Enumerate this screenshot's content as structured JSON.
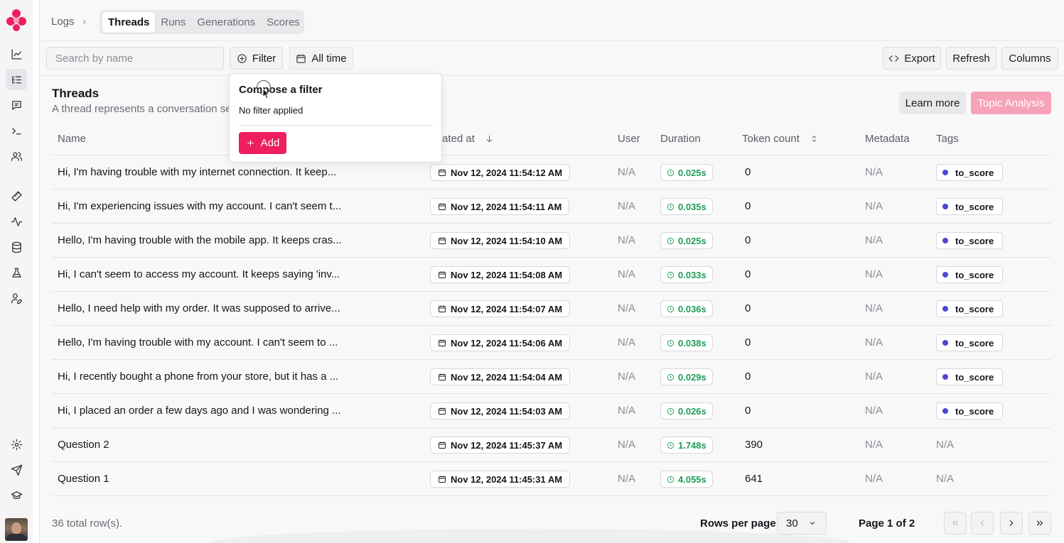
{
  "brand": {
    "accent": "#ef1e5f",
    "accent_light": "#f6a2b8"
  },
  "nav": {
    "items": [
      {
        "icon": "chart-line-icon"
      },
      {
        "icon": "list-tree-icon",
        "active": true
      },
      {
        "icon": "message-square-icon"
      },
      {
        "icon": "terminal-icon"
      },
      {
        "icon": "users-icon"
      },
      {
        "icon": "ruler-icon"
      },
      {
        "icon": "activity-icon"
      },
      {
        "icon": "database-icon"
      },
      {
        "icon": "flask-icon"
      },
      {
        "icon": "user-pen-icon"
      }
    ],
    "bottom_items": [
      {
        "icon": "settings-gear-icon"
      },
      {
        "icon": "send-icon"
      },
      {
        "icon": "graduation-cap-icon"
      }
    ]
  },
  "header": {
    "breadcrumb": "Logs",
    "tabs": [
      {
        "label": "Threads",
        "active": true
      },
      {
        "label": "Runs"
      },
      {
        "label": "Generations"
      },
      {
        "label": "Scores"
      }
    ]
  },
  "toolbar": {
    "search_placeholder": "Search by name",
    "filter_label": "Filter",
    "time_label": "All time",
    "export_label": "Export",
    "refresh_label": "Refresh",
    "columns_label": "Columns"
  },
  "section": {
    "title": "Threads",
    "subtitle": "A thread represents a conversation se",
    "learn_more": "Learn more",
    "topic_analysis": "Topic Analysis"
  },
  "popover": {
    "title": "Compose a filter",
    "subtitle": "No filter applied",
    "add_label": "Add"
  },
  "table": {
    "columns": {
      "name": "Name",
      "created_at": "ated at",
      "user": "User",
      "duration": "Duration",
      "token_count": "Token count",
      "metadata": "Metadata",
      "tags": "Tags"
    },
    "rows": [
      {
        "name": "Hi, I'm having trouble with my internet connection. It keep...",
        "created": "Nov 12, 2024 11:54:12 AM",
        "user": "N/A",
        "duration": "0.025s",
        "tokens": "0",
        "metadata": "N/A",
        "tag": "to_score"
      },
      {
        "name": "Hi, I'm experiencing issues with my account. I can't seem t...",
        "created": "Nov 12, 2024 11:54:11 AM",
        "user": "N/A",
        "duration": "0.035s",
        "tokens": "0",
        "metadata": "N/A",
        "tag": "to_score"
      },
      {
        "name": "Hello, I'm having trouble with the mobile app. It keeps cras...",
        "created": "Nov 12, 2024 11:54:10 AM",
        "user": "N/A",
        "duration": "0.025s",
        "tokens": "0",
        "metadata": "N/A",
        "tag": "to_score"
      },
      {
        "name": "Hi, I can't seem to access my account. It keeps saying 'inv...",
        "created": "Nov 12, 2024 11:54:08 AM",
        "user": "N/A",
        "duration": "0.033s",
        "tokens": "0",
        "metadata": "N/A",
        "tag": "to_score"
      },
      {
        "name": "Hello, I need help with my order. It was supposed to arrive...",
        "created": "Nov 12, 2024 11:54:07 AM",
        "user": "N/A",
        "duration": "0.036s",
        "tokens": "0",
        "metadata": "N/A",
        "tag": "to_score"
      },
      {
        "name": "Hello, I'm having trouble with my account. I can't seem to ...",
        "created": "Nov 12, 2024 11:54:06 AM",
        "user": "N/A",
        "duration": "0.038s",
        "tokens": "0",
        "metadata": "N/A",
        "tag": "to_score"
      },
      {
        "name": "Hi, I recently bought a phone from your store, but it has a ...",
        "created": "Nov 12, 2024 11:54:04 AM",
        "user": "N/A",
        "duration": "0.029s",
        "tokens": "0",
        "metadata": "N/A",
        "tag": "to_score"
      },
      {
        "name": "Hi, I placed an order a few days ago and I was wondering ...",
        "created": "Nov 12, 2024 11:54:03 AM",
        "user": "N/A",
        "duration": "0.026s",
        "tokens": "0",
        "metadata": "N/A",
        "tag": "to_score"
      },
      {
        "name": "Question 2",
        "created": "Nov 12, 2024 11:45:37 AM",
        "user": "N/A",
        "duration": "1.748s",
        "tokens": "390",
        "metadata": "N/A",
        "tag": "N/A"
      },
      {
        "name": "Question 1",
        "created": "Nov 12, 2024 11:45:31 AM",
        "user": "N/A",
        "duration": "4.055s",
        "tokens": "641",
        "metadata": "N/A",
        "tag": "N/A"
      }
    ]
  },
  "footer": {
    "total": "36 total row(s).",
    "rows_per_page_label": "Rows per page",
    "rows_per_page": "30",
    "page_info": "Page 1 of 2"
  }
}
